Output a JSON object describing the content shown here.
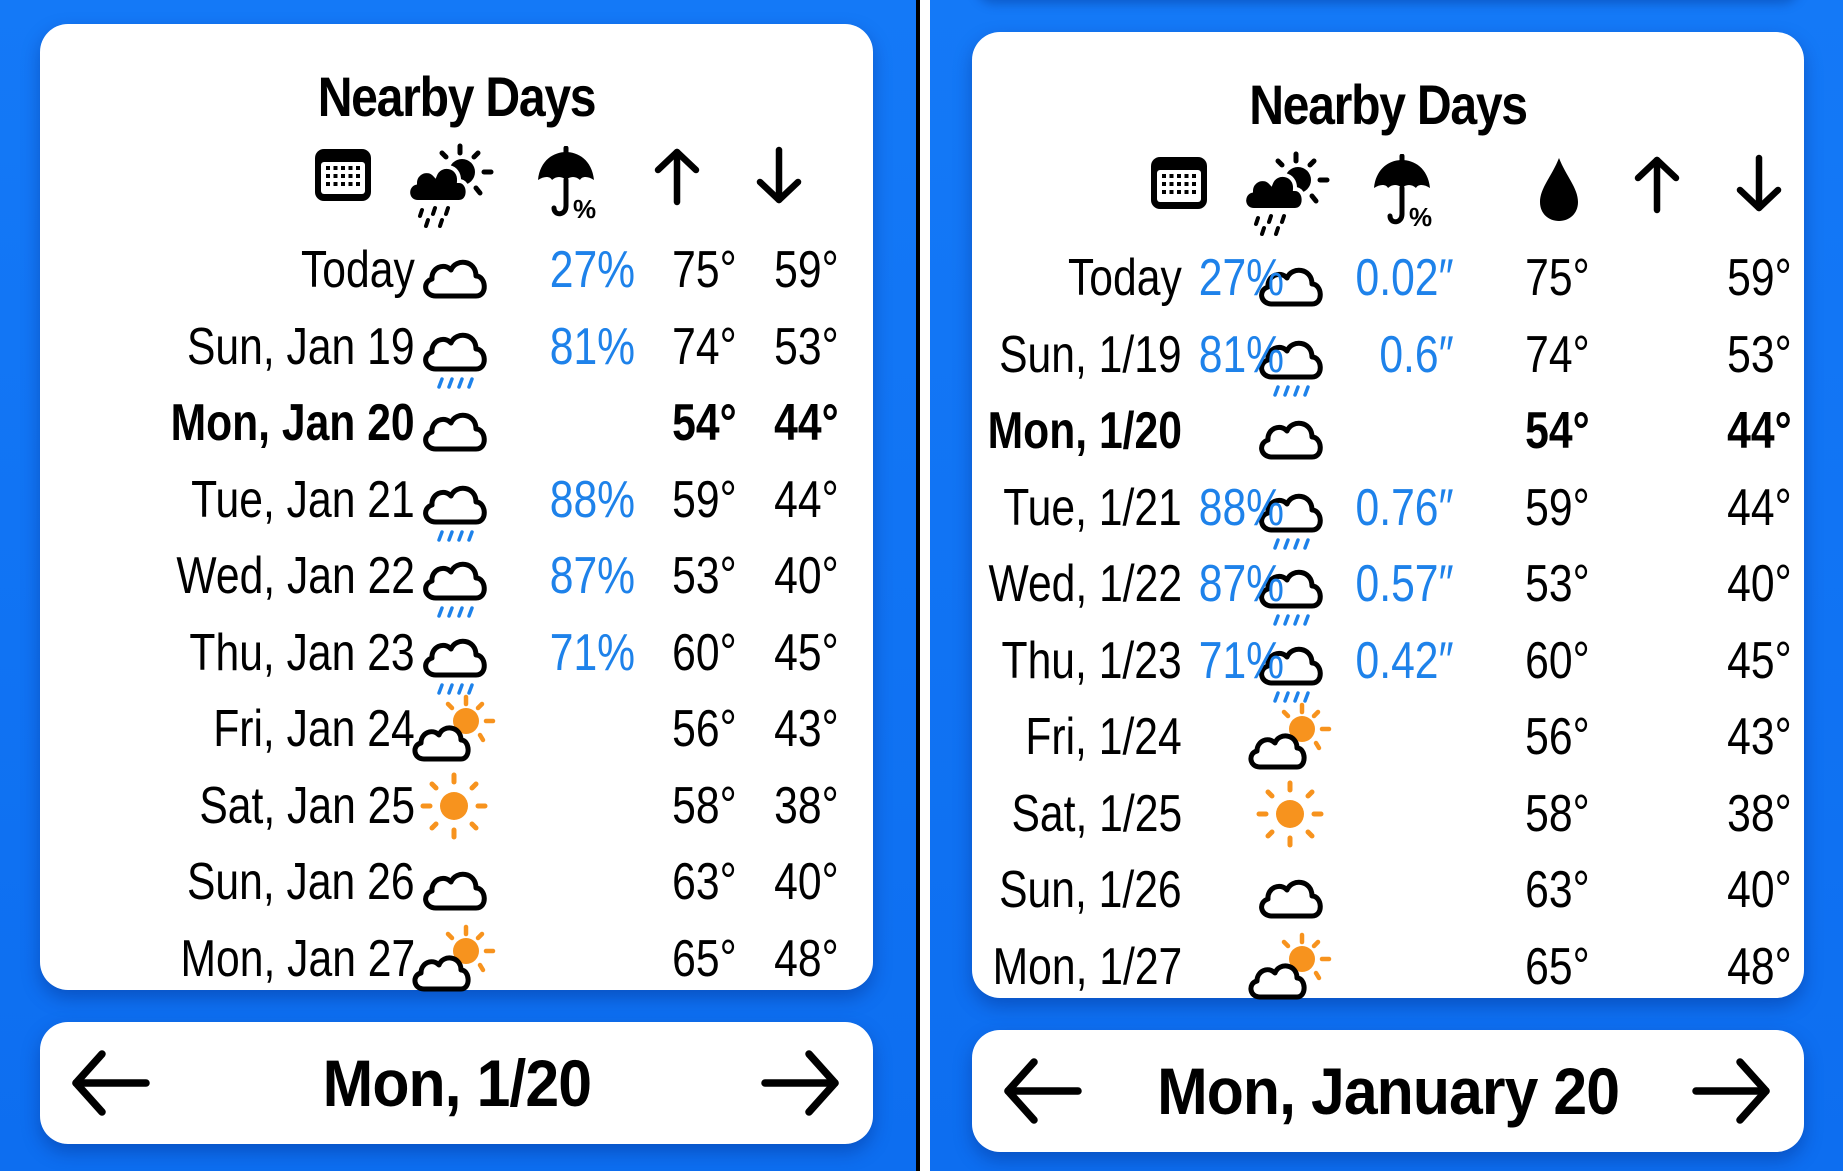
{
  "colors": {
    "background": "#0d6ef0",
    "card": "#ffffff",
    "precip_blue": "#1e82ea",
    "sun_orange": "#f7931e",
    "text": "#000000"
  },
  "left_panel": {
    "title": "Nearby Days",
    "header_icons": [
      "calendar-icon",
      "cloud-sun-rain-icon",
      "umbrella-percent-icon",
      "arrow-up-icon",
      "arrow-down-icon"
    ],
    "rows": [
      {
        "date": "Today",
        "icon": "cloud",
        "precip_chance": "27%",
        "high": "75°",
        "low": "59°",
        "selected": false
      },
      {
        "date": "Sun, Jan 19",
        "icon": "cloud-rain",
        "precip_chance": "81%",
        "high": "74°",
        "low": "53°",
        "selected": false
      },
      {
        "date": "Mon, Jan 20",
        "icon": "cloud",
        "precip_chance": "",
        "high": "54°",
        "low": "44°",
        "selected": true
      },
      {
        "date": "Tue, Jan 21",
        "icon": "cloud-rain",
        "precip_chance": "88%",
        "high": "59°",
        "low": "44°",
        "selected": false
      },
      {
        "date": "Wed, Jan 22",
        "icon": "cloud-rain",
        "precip_chance": "87%",
        "high": "53°",
        "low": "40°",
        "selected": false
      },
      {
        "date": "Thu, Jan 23",
        "icon": "cloud-rain",
        "precip_chance": "71%",
        "high": "60°",
        "low": "45°",
        "selected": false
      },
      {
        "date": "Fri, Jan 24",
        "icon": "cloud-sun",
        "precip_chance": "",
        "high": "56°",
        "low": "43°",
        "selected": false
      },
      {
        "date": "Sat, Jan 25",
        "icon": "sun",
        "precip_chance": "",
        "high": "58°",
        "low": "38°",
        "selected": false
      },
      {
        "date": "Sun, Jan 26",
        "icon": "cloud",
        "precip_chance": "",
        "high": "63°",
        "low": "40°",
        "selected": false
      },
      {
        "date": "Mon, Jan 27",
        "icon": "cloud-sun",
        "precip_chance": "",
        "high": "65°",
        "low": "48°",
        "selected": false
      }
    ],
    "nav": {
      "label": "Mon, 1/20",
      "prev": "previous-day",
      "next": "next-day"
    }
  },
  "right_panel": {
    "title": "Nearby Days",
    "header_icons": [
      "calendar-icon",
      "cloud-sun-rain-icon",
      "umbrella-percent-icon",
      "raindrop-icon",
      "arrow-up-icon",
      "arrow-down-icon"
    ],
    "rows": [
      {
        "date": "Today",
        "icon": "cloud",
        "precip_chance": "27%",
        "precip_amount": "0.02″",
        "high": "75°",
        "low": "59°",
        "selected": false
      },
      {
        "date": "Sun, 1/19",
        "icon": "cloud-rain",
        "precip_chance": "81%",
        "precip_amount": "0.6″",
        "high": "74°",
        "low": "53°",
        "selected": false
      },
      {
        "date": "Mon, 1/20",
        "icon": "cloud",
        "precip_chance": "",
        "precip_amount": "",
        "high": "54°",
        "low": "44°",
        "selected": true
      },
      {
        "date": "Tue, 1/21",
        "icon": "cloud-rain",
        "precip_chance": "88%",
        "precip_amount": "0.76″",
        "high": "59°",
        "low": "44°",
        "selected": false
      },
      {
        "date": "Wed, 1/22",
        "icon": "cloud-rain",
        "precip_chance": "87%",
        "precip_amount": "0.57″",
        "high": "53°",
        "low": "40°",
        "selected": false
      },
      {
        "date": "Thu, 1/23",
        "icon": "cloud-rain",
        "precip_chance": "71%",
        "precip_amount": "0.42″",
        "high": "60°",
        "low": "45°",
        "selected": false
      },
      {
        "date": "Fri, 1/24",
        "icon": "cloud-sun",
        "precip_chance": "",
        "precip_amount": "",
        "high": "56°",
        "low": "43°",
        "selected": false
      },
      {
        "date": "Sat, 1/25",
        "icon": "sun",
        "precip_chance": "",
        "precip_amount": "",
        "high": "58°",
        "low": "38°",
        "selected": false
      },
      {
        "date": "Sun, 1/26",
        "icon": "cloud",
        "precip_chance": "",
        "precip_amount": "",
        "high": "63°",
        "low": "40°",
        "selected": false
      },
      {
        "date": "Mon, 1/27",
        "icon": "cloud-sun",
        "precip_chance": "",
        "precip_amount": "",
        "high": "65°",
        "low": "48°",
        "selected": false
      }
    ],
    "nav": {
      "label": "Mon, January 20",
      "prev": "previous-day",
      "next": "next-day"
    }
  }
}
